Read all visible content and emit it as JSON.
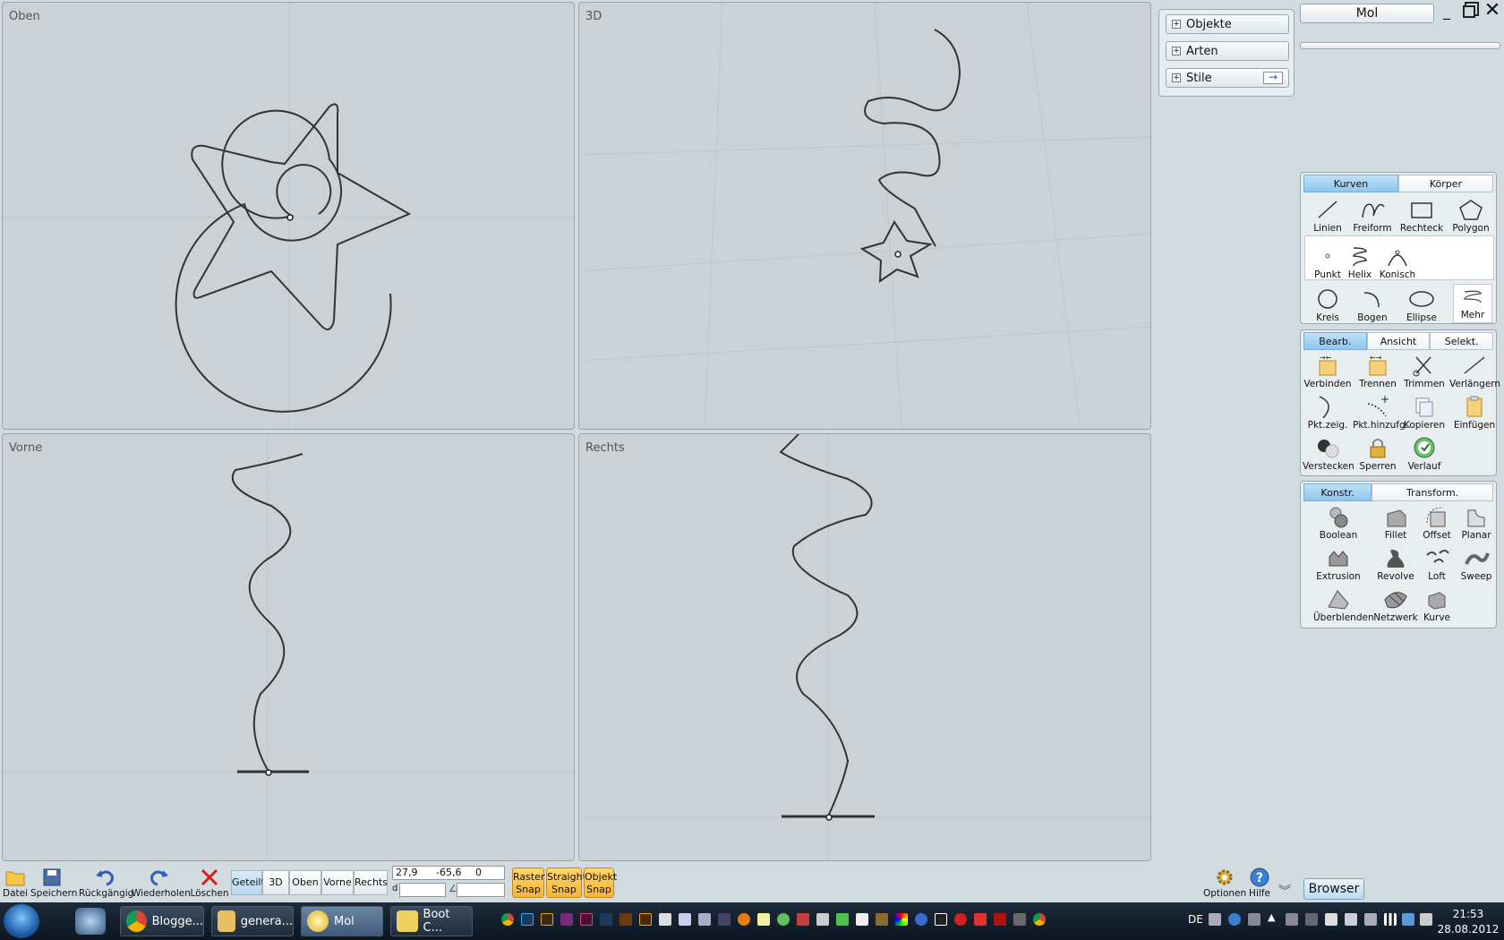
{
  "viewports": {
    "top": {
      "label": "Oben"
    },
    "persp": {
      "label": "3D"
    },
    "front": {
      "label": "Vorne"
    },
    "right": {
      "label": "Rechts"
    }
  },
  "side_panels": {
    "objects": "Objekte",
    "types": "Arten",
    "styles": "Stile"
  },
  "window": {
    "title": "Mol"
  },
  "curves": {
    "tabs": [
      "Kurven",
      "Körper"
    ],
    "tools": [
      "Linien",
      "Freiform",
      "Rechteck",
      "Polygon",
      "Punkt",
      "Helix",
      "Konisch",
      "Kreis",
      "Bogen",
      "Ellipse",
      "Mehr"
    ]
  },
  "edit": {
    "tabs": [
      "Bearb.",
      "Ansicht",
      "Selekt."
    ],
    "tools": [
      "Verbinden",
      "Trennen",
      "Trimmen",
      "Verlängern",
      "Pkt.zeig.",
      "Pkt.hinzufg.",
      "Kopieren",
      "Einfügen",
      "Verstecken",
      "Sperren",
      "Verlauf"
    ]
  },
  "construct": {
    "tabs": [
      "Konstr.",
      "Transform."
    ],
    "tools": [
      "Boolean",
      "Fillet",
      "Offset",
      "Planar",
      "Extrusion",
      "Revolve",
      "Loft",
      "Sweep",
      "Überblenden",
      "Netzwerk",
      "Kurve"
    ]
  },
  "toolbar": {
    "file": "Datei",
    "save": "Speichern",
    "undo": "Rückgängig",
    "redo": "Wiederholen",
    "delete": "Löschen",
    "views": [
      "Geteilt",
      "3D",
      "Oben",
      "Vorne",
      "Rechts"
    ],
    "coord_x": "27,9",
    "coord_y": "-65,6",
    "coord_z": "0",
    "dist_label": "d",
    "angle_label": "∠",
    "snaps": [
      [
        "Raster",
        "Snap"
      ],
      [
        "Straight",
        "Snap"
      ],
      [
        "Objekt",
        "Snap"
      ]
    ],
    "options": "Optionen",
    "help": "Hilfe",
    "browser": "Browser"
  },
  "taskbar": {
    "tasks": [
      "Blogge...",
      "genera...",
      "Mol",
      "Boot C..."
    ],
    "lang": "DE",
    "time": "21:53",
    "date": "28.08.2012"
  },
  "colors": {
    "snap": "#f5b53a",
    "active_tab": "#8fc6ee",
    "viewport_bg": "#ccd1d6",
    "taskbar": "#16212e"
  }
}
